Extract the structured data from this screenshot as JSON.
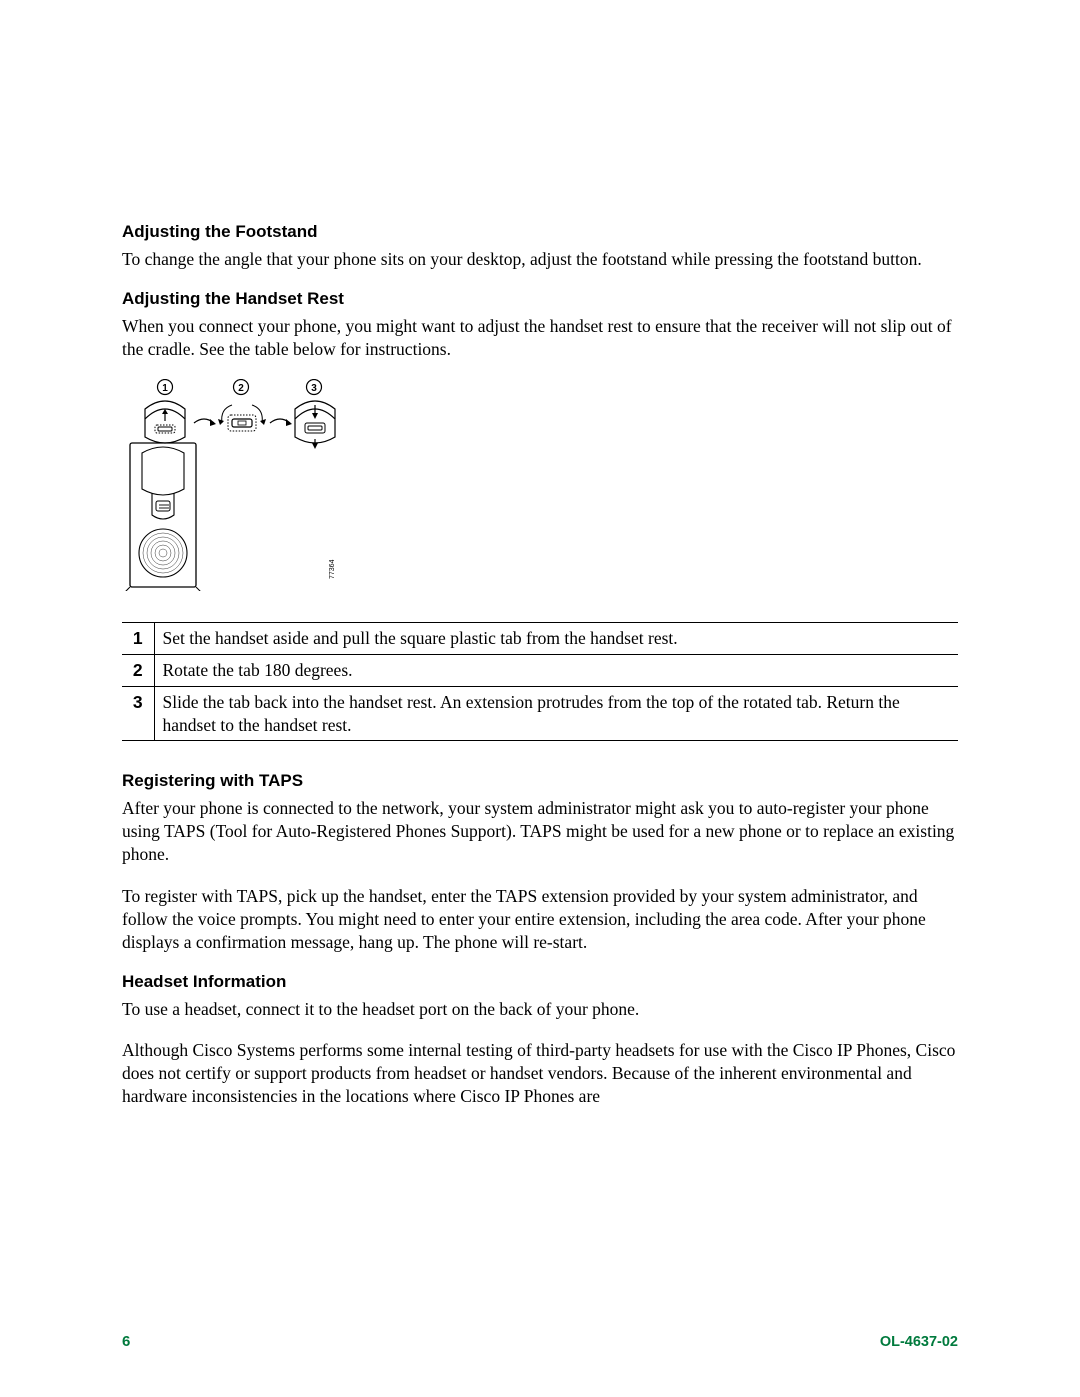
{
  "sections": {
    "footstand": {
      "heading": "Adjusting the Footstand",
      "body": "To change the angle that your phone sits on your desktop, adjust the footstand while pressing the footstand button."
    },
    "handset": {
      "heading": "Adjusting the Handset Rest",
      "body": "When you connect your phone, you might want to adjust the handset rest to ensure that the receiver will not slip out of the cradle. See the table below for instructions."
    },
    "steps": [
      {
        "num": "1",
        "text": "Set the handset aside and pull the square plastic tab from the handset rest."
      },
      {
        "num": "2",
        "text": "Rotate the tab 180 degrees."
      },
      {
        "num": "3",
        "text": "Slide the tab back into the handset rest. An extension protrudes from the top of the rotated tab. Return the handset to the handset rest."
      }
    ],
    "taps": {
      "heading": "Registering with TAPS",
      "p1": "After your phone is connected to the network, your system administrator might ask you to auto-register your phone using TAPS (Tool for Auto-Registered Phones Support). TAPS might be used for a new phone or to replace an existing phone.",
      "p2": "To register with TAPS, pick up the handset, enter the TAPS extension provided by your system administrator, and follow the voice prompts. You might need to enter your entire extension, including the area code. After your phone displays a confirmation message, hang up. The phone will re-start."
    },
    "headset": {
      "heading": "Headset Information",
      "p1": "To use a headset, connect it to the headset port on the back of your phone.",
      "p2": "Although Cisco Systems performs some internal testing of third-party headsets for use with the Cisco IP Phones, Cisco does not certify or support products from headset or handset vendors. Because of the inherent environmental and hardware inconsistencies in the locations where Cisco IP Phones are"
    }
  },
  "diagram": {
    "figure_label": "77364"
  },
  "footer": {
    "page": "6",
    "docref": "OL-4637-02"
  }
}
